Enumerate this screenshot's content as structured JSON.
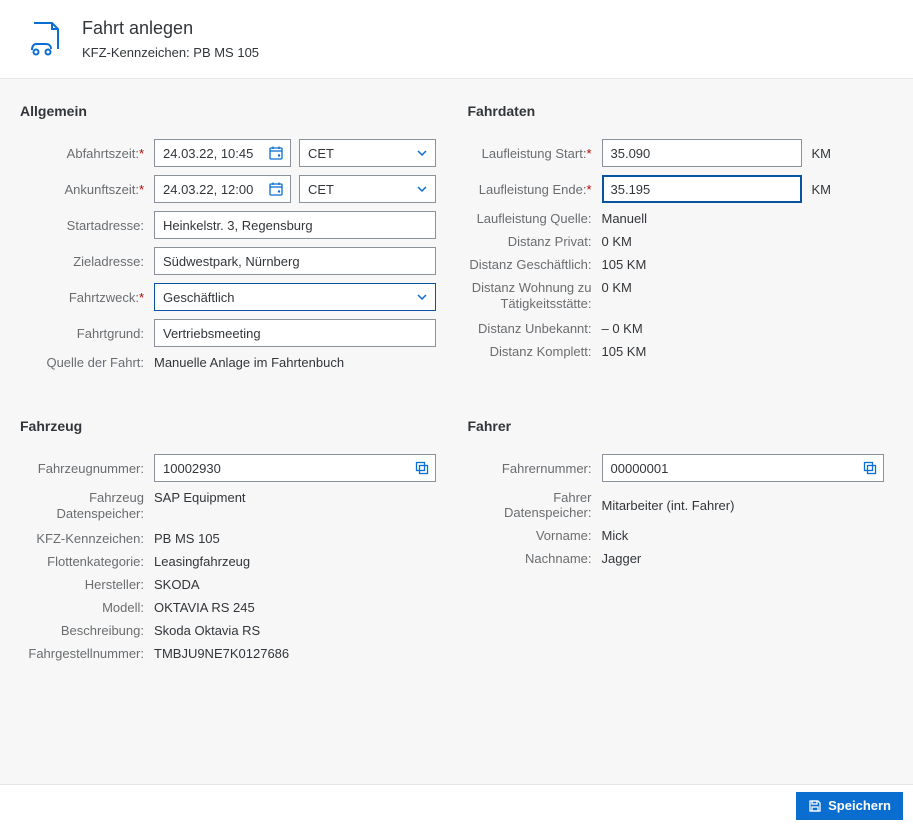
{
  "header": {
    "title": "Fahrt anlegen",
    "subtitle": "KFZ-Kennzeichen: PB MS 105"
  },
  "allgemein": {
    "title": "Allgemein",
    "labels": {
      "abfahrtszeit": "Abfahrtszeit:",
      "ankunftszeit": "Ankunftszeit:",
      "startadresse": "Startadresse:",
      "zieladresse": "Zieladresse:",
      "fahrtzweck": "Fahrtzweck:",
      "fahrtgrund": "Fahrtgrund:",
      "quelle": "Quelle der Fahrt:"
    },
    "abfahrtszeit": "24.03.22, 10:45",
    "abfahrtszeit_tz": "CET",
    "ankunftszeit": "24.03.22, 12:00",
    "ankunftszeit_tz": "CET",
    "startadresse": "Heinkelstr. 3, Regensburg",
    "zieladresse": "Südwestpark, Nürnberg",
    "fahrtzweck": "Geschäftlich",
    "fahrtgrund": "Vertriebsmeeting",
    "quelle": "Manuelle Anlage im Fahrtenbuch"
  },
  "fahrdaten": {
    "title": "Fahrdaten",
    "labels": {
      "laufleistung_start": "Laufleistung Start:",
      "laufleistung_ende": "Laufleistung Ende:",
      "laufleistung_quelle": "Laufleistung Quelle:",
      "distanz_privat": "Distanz Privat:",
      "distanz_geschaeftlich": "Distanz Geschäftlich:",
      "distanz_wohnung": "Distanz Wohnung zu Tätigkeitsstätte:",
      "distanz_unbekannt": "Distanz Unbekannt:",
      "distanz_komplett": "Distanz Komplett:",
      "km": "KM"
    },
    "laufleistung_start": "35.090",
    "laufleistung_ende": "35.195",
    "laufleistung_quelle": "Manuell",
    "distanz_privat": "0 KM",
    "distanz_geschaeftlich": "105 KM",
    "distanz_wohnung": "0 KM",
    "distanz_unbekannt": "– 0 KM",
    "distanz_komplett": "105 KM"
  },
  "fahrzeug": {
    "title": "Fahrzeug",
    "labels": {
      "fahrzeugnummer": "Fahrzeugnummer:",
      "datenspeicher": "Fahrzeug Datenspeicher:",
      "kennzeichen": "KFZ-Kennzeichen:",
      "flottenkategorie": "Flottenkategorie:",
      "hersteller": "Hersteller:",
      "modell": "Modell:",
      "beschreibung": "Beschreibung:",
      "fahrgestellnummer": "Fahrgestellnummer:"
    },
    "fahrzeugnummer": "10002930",
    "datenspeicher": "SAP Equipment",
    "kennzeichen": "PB MS 105",
    "flottenkategorie": "Leasingfahrzeug",
    "hersteller": "SKODA",
    "modell": "OKTAVIA RS 245",
    "beschreibung": "Skoda Oktavia RS",
    "fahrgestellnummer": "TMBJU9NE7K0127686"
  },
  "fahrer": {
    "title": "Fahrer",
    "labels": {
      "fahrernummer": "Fahrernummer:",
      "datenspeicher": "Fahrer Datenspeicher:",
      "vorname": "Vorname:",
      "nachname": "Nachname:"
    },
    "fahrernummer": "00000001",
    "datenspeicher": "Mitarbeiter (int. Fahrer)",
    "vorname": "Mick",
    "nachname": "Jagger"
  },
  "footer": {
    "speichern": "Speichern"
  }
}
